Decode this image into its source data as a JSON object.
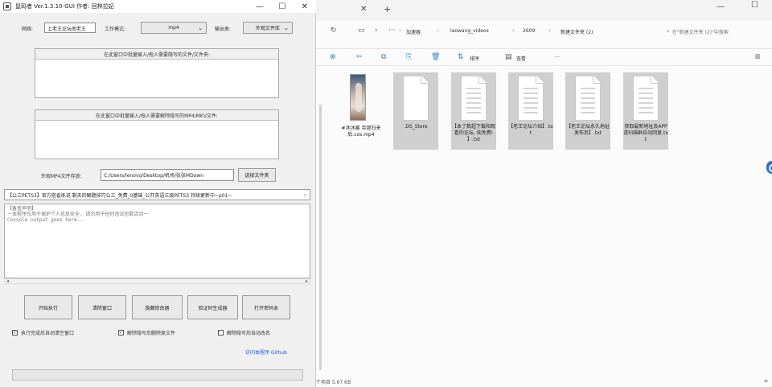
{
  "app": {
    "title": "鼠码者 Ver.1.3.10-GUI 作者: 回林拉妃",
    "min_glyph": "—",
    "max_glyph": "☐",
    "close_glyph": "✕",
    "row1": {
      "id_label": "网络:",
      "id_value": "上老王论坛南老王",
      "mode_label": "工作模式:",
      "mode_value": "mp4",
      "output_label": "输出类:",
      "output_value": "外观文件库"
    },
    "group1_title": "在此窗口中批量输入/拖入需要隐写的文件/文件夹:",
    "group2_title": "在此窗口中批量输入/拖入需要解除隐写的MP4/MKV文件:",
    "mp4_label": "外观MP4文件存放:",
    "mp4_path": "C:/Users/lenovo/Desktop/机场/张张MDown",
    "mp4_button": "选择文件夹",
    "bigcombo_value": "【公三PETS3】官方搭雀练说 剩天的解题技巧公三_免费_0基础_公开英语三级PETS3 持续更新中~p01~",
    "console_lines": [
      "【备查声明】",
      "一本程序仅用于保护个人信息安全, 请勿用于任何违法犯罪活动一",
      "Console output goes here..."
    ],
    "buttons": [
      "开始执行",
      "清除窗口",
      "隐藏修改器",
      "验证码生成器",
      "打开密码本"
    ],
    "checks": [
      {
        "label": "执行完成后自动清空窗口",
        "checked": true
      },
      {
        "label": "解除隐写后删除原文件",
        "checked": true
      },
      {
        "label": "解除隐写后自动改名",
        "checked": false
      }
    ],
    "link": "访问本程序 Github"
  },
  "explorer": {
    "tab_close": "✕",
    "tab_new": "+",
    "min_glyph": "—",
    "max_glyph": "☐",
    "breadcrumbs": [
      "加速器",
      "laowang_videos",
      "2609",
      "新建文件夹 (2)"
    ],
    "search_placeholder": "在\"新建文件夹 (2)\"中搜索",
    "sort_label": "排序",
    "view_label": "查看",
    "more_label": "···",
    "files": [
      {
        "name": "#沐沐酱 旦那归来后.cos.mp4",
        "type": "video"
      },
      {
        "name": ".DS_Store",
        "type": "blank"
      },
      {
        "name": "【本了数超下载和观看的论坛, 纯免费! 】.txt",
        "type": "txt"
      },
      {
        "name": "【老王论坛介绍】.txt",
        "type": "txt"
      },
      {
        "name": "【老王论坛永久地址发布页】.txt",
        "type": "txt"
      },
      {
        "name": "获取最新地址及APP请扫描群自动回复.txt",
        "type": "txt"
      }
    ],
    "status": "个项目  5.67 KB"
  }
}
